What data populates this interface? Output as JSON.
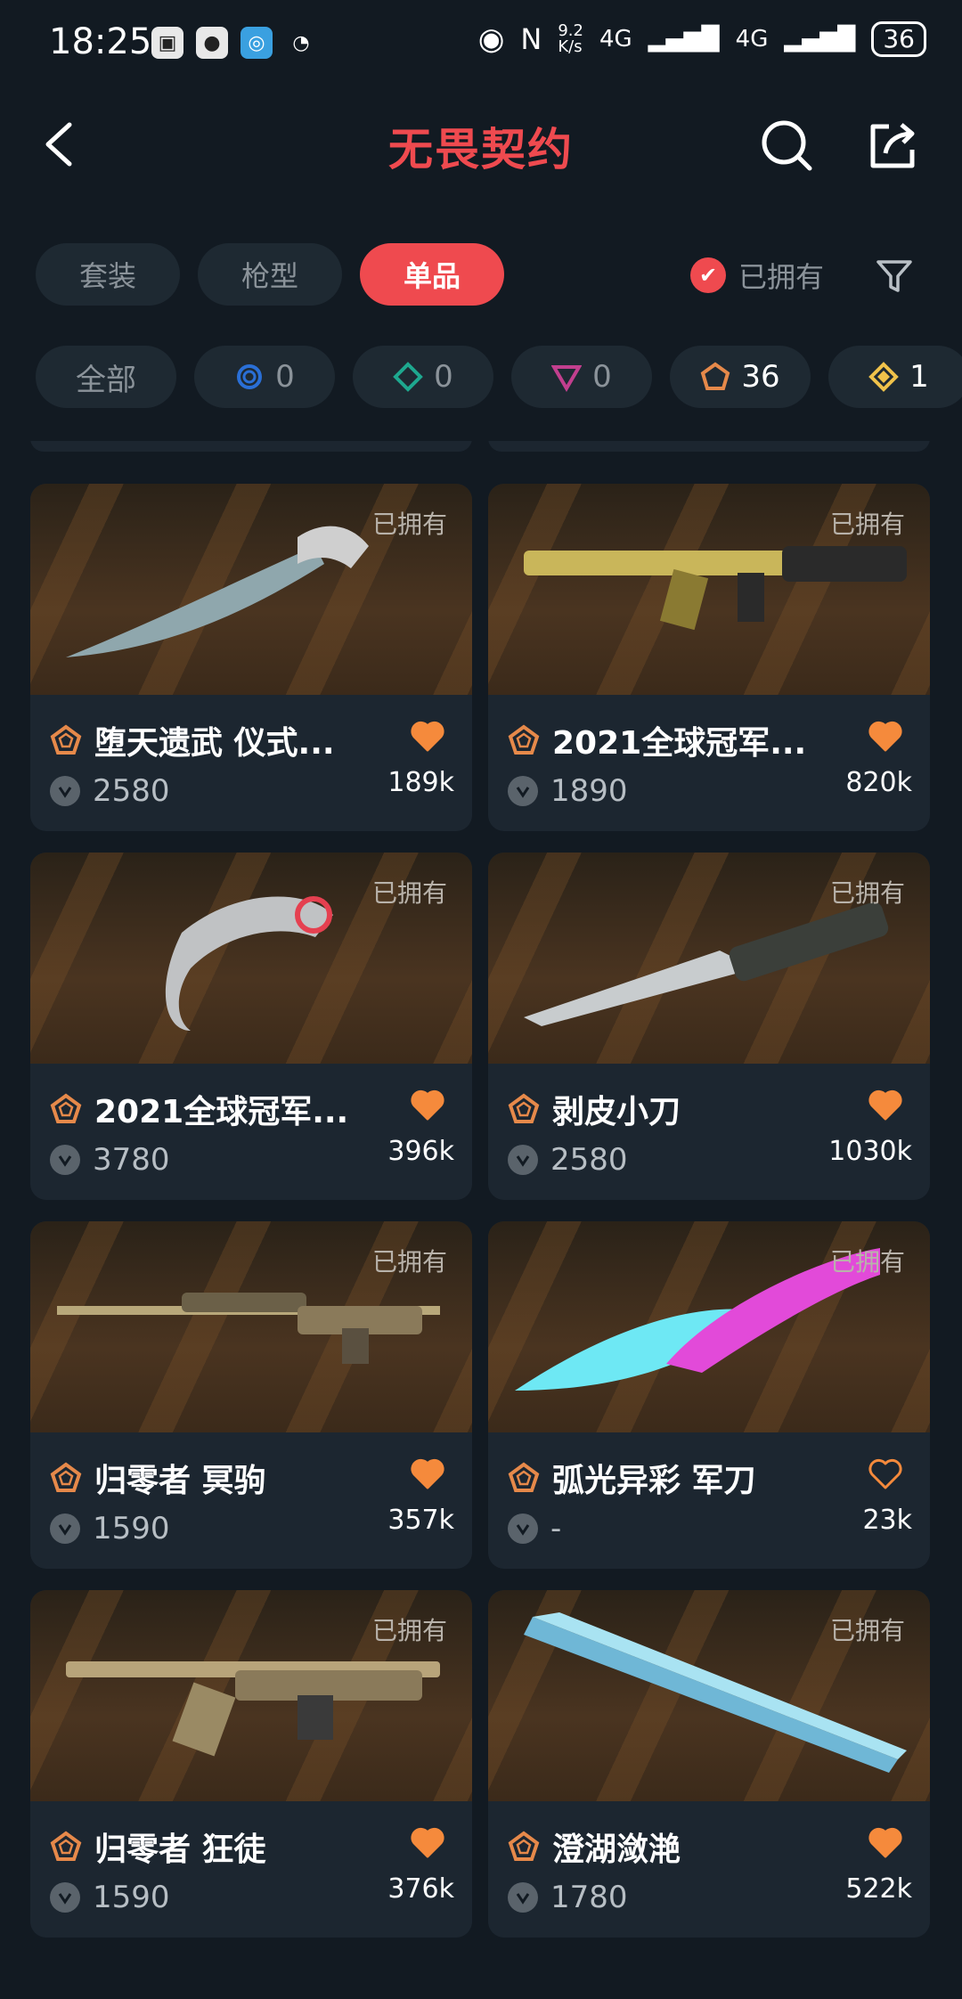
{
  "status_bar": {
    "time": "18:25",
    "speed": "9.2\nK/s",
    "net1": "4G",
    "net2": "4G",
    "battery": "36"
  },
  "header": {
    "title": "无畏契约"
  },
  "tabs": [
    {
      "label": "套装"
    },
    {
      "label": "枪型"
    },
    {
      "label": "单品"
    }
  ],
  "owned_toggle": {
    "label": "已拥有"
  },
  "rarity_chips": [
    {
      "label": "全部"
    },
    {
      "count": "0",
      "color": "#2a6fd6"
    },
    {
      "count": "0",
      "color": "#1ea88f"
    },
    {
      "count": "0",
      "color": "#c23f8e"
    },
    {
      "count": "36",
      "color": "#e6894a"
    },
    {
      "count": "1",
      "color": "#f0c24a"
    }
  ],
  "colors": {
    "accent": "#ef4a4f",
    "heart": "#f58a3c",
    "tier": "#e6894a"
  },
  "items": [
    {
      "owned": "已拥有",
      "name": "堕天遗武 仪式...",
      "price": "2580",
      "likes": "189k",
      "liked": true,
      "art": "karambit-blade"
    },
    {
      "owned": "已拥有",
      "name": "2021全球冠军...",
      "price": "1890",
      "likes": "820k",
      "liked": true,
      "art": "rifle"
    },
    {
      "owned": "已拥有",
      "name": "2021全球冠军...",
      "price": "3780",
      "likes": "396k",
      "liked": true,
      "art": "karambit"
    },
    {
      "owned": "已拥有",
      "name": "剥皮小刀",
      "price": "2580",
      "likes": "1030k",
      "liked": true,
      "art": "knife"
    },
    {
      "owned": "已拥有",
      "name": "归零者 冥驹",
      "price": "1590",
      "likes": "357k",
      "liked": true,
      "art": "sniper"
    },
    {
      "owned": "已拥有",
      "name": "弧光异彩 军刀",
      "price": "-",
      "likes": "23k",
      "liked": false,
      "art": "neon-knife"
    },
    {
      "owned": "已拥有",
      "name": "归零者 狂徒",
      "price": "1590",
      "likes": "376k",
      "liked": true,
      "art": "rifle-gold"
    },
    {
      "owned": "已拥有",
      "name": "澄湖潋滟",
      "price": "1780",
      "likes": "522k",
      "liked": true,
      "art": "fan"
    }
  ]
}
